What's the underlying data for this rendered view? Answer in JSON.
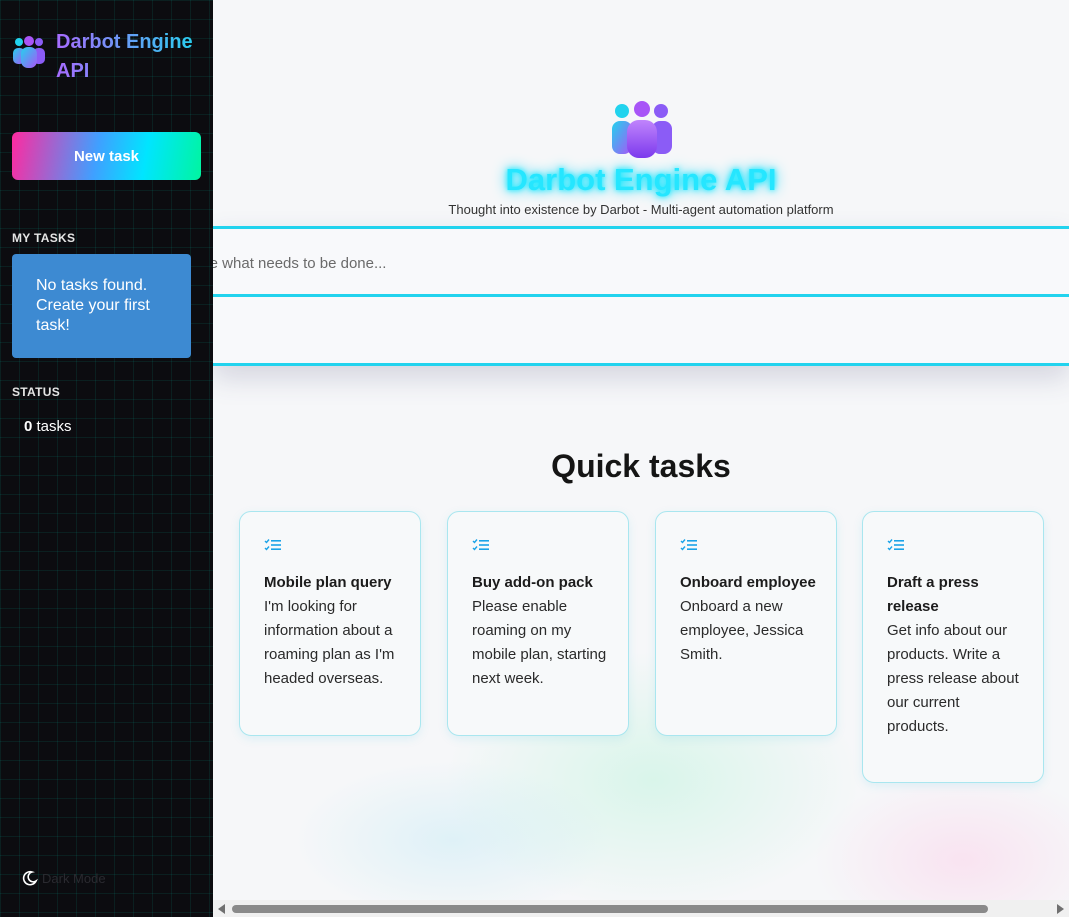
{
  "sidebar": {
    "brand_title": "Darbot Engine API",
    "new_task_label": "New task",
    "my_tasks_heading": "MY TASKS",
    "no_tasks_message": "No tasks found. Create your first task!",
    "status_heading": "STATUS",
    "status_count": "0",
    "status_suffix": " tasks",
    "dark_mode_label": "Dark Mode"
  },
  "hero": {
    "title": "Darbot Engine API",
    "subtitle": "Thought into existence by Darbot - Multi-agent automation platform"
  },
  "input": {
    "placeholder": "ribe what needs to be done...",
    "secondary_glyph": ")"
  },
  "quick_tasks": {
    "heading": "Quick tasks",
    "cards": [
      {
        "icon": "task-list-icon",
        "title": "Mobile plan query",
        "description": "I'm looking for information about a roaming plan as I'm headed overseas."
      },
      {
        "icon": "task-list-icon",
        "title": "Buy add-on pack",
        "description": "Please enable roaming on my mobile plan, starting next week."
      },
      {
        "icon": "task-list-icon",
        "title": "Onboard employee",
        "description": "Onboard a new employee, Jessica Smith."
      },
      {
        "icon": "task-list-icon",
        "title": "Draft a press release",
        "description": "Get info about our products. Write a press release about our current products."
      }
    ]
  },
  "colors": {
    "accent_cyan": "#22d3ee",
    "sidebar_bg": "#0c0c10",
    "no_tasks_bg": "#3d8ad2",
    "brand_gradient_start": "#a86bff",
    "brand_gradient_end": "#22d3ee"
  }
}
